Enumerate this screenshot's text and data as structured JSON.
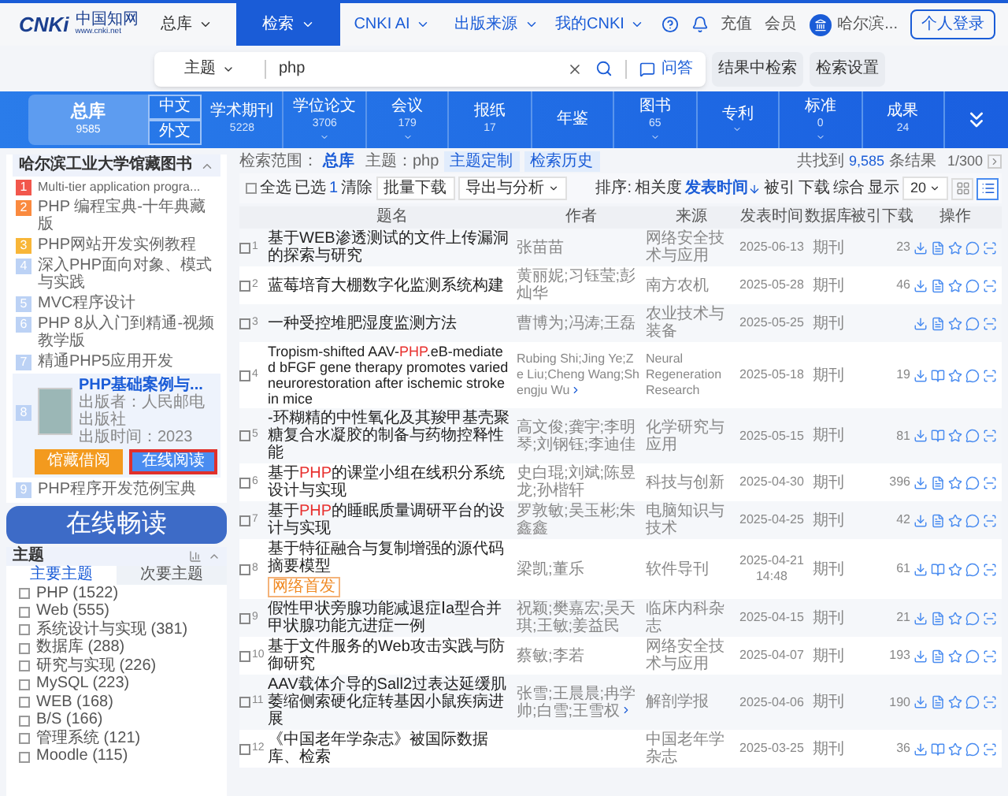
{
  "header": {
    "logo": {
      "mark": "CNKi",
      "name": "中国知网",
      "url": "www.cnki.net"
    },
    "library_menu": "总库",
    "nav": [
      {
        "label": "检索",
        "selected": true
      },
      {
        "label": "CNKI AI",
        "selected": false
      },
      {
        "label": "出版来源",
        "selected": false
      },
      {
        "label": "我的CNKI",
        "selected": false
      }
    ],
    "links": [
      "充值",
      "会员"
    ],
    "user": "哈尔滨...",
    "login": "个人登录"
  },
  "search": {
    "field": "主题",
    "value": "php",
    "qa": "问答",
    "buttons": [
      "结果中检索",
      "检索设置"
    ]
  },
  "db_band": {
    "total": {
      "label": "总库",
      "count": "9585",
      "selected": true
    },
    "langs": [
      {
        "label": "中文",
        "selected": false
      },
      {
        "label": "外文",
        "selected": false
      }
    ],
    "categories": [
      {
        "label": "学术期刊",
        "count": "5228",
        "has_menu": false
      },
      {
        "label": "学位论文",
        "count": "3706",
        "has_menu": true
      },
      {
        "label": "会议",
        "count": "179",
        "has_menu": true
      },
      {
        "label": "报纸",
        "count": "17",
        "has_menu": false
      },
      {
        "label": "年鉴",
        "has_menu": false
      },
      {
        "label": "图书",
        "count": "65",
        "has_menu": true
      },
      {
        "label": "专利",
        "has_menu": true
      },
      {
        "label": "标准",
        "count": "0",
        "has_menu": true
      },
      {
        "label": "成果",
        "count": "24",
        "has_menu": false
      }
    ]
  },
  "library": {
    "title": "哈尔滨工业大学馆藏图书",
    "expanded": true,
    "items": [
      {
        "kind": "line",
        "rank": "1",
        "color": "#f2574c",
        "title": "Multi-tier application progra..."
      },
      {
        "kind": "line",
        "rank": "2",
        "color": "#fa8a3f",
        "title": "PHP 编程宝典-十年典藏版"
      },
      {
        "kind": "line",
        "rank": "3",
        "color": "#f8b638",
        "title": "PHP网站开发实例教程"
      },
      {
        "kind": "line",
        "rank": "4",
        "color": "#bcd2f5",
        "title": "深入PHP面向对象、模式与实践"
      },
      {
        "kind": "line",
        "rank": "5",
        "color": "#bcd2f5",
        "title": "MVC程序设计"
      },
      {
        "kind": "line",
        "rank": "6",
        "color": "#bcd2f5",
        "title": "PHP 8从入门到精通-视频教学版"
      },
      {
        "kind": "line",
        "rank": "7",
        "color": "#bcd2f5",
        "title": "精通PHP5应用开发"
      },
      {
        "kind": "card",
        "rank": "8",
        "color": "#bcd2f5",
        "title": "PHP基础案例与...",
        "publisher": "出版者：人民邮电出版社",
        "year": "出版时间：2023",
        "buttons": [
          {
            "label": "馆藏借阅",
            "highlighted": false
          },
          {
            "label": "在线阅读",
            "highlighted": true
          }
        ]
      },
      {
        "kind": "line",
        "rank": "9",
        "color": "#bcd2f5",
        "title": "PHP程序开发范例宝典"
      }
    ]
  },
  "overlay_caption": "在线畅读",
  "subjects": {
    "title": "主题",
    "expanded": true,
    "tabs": [
      {
        "label": "主要主题",
        "selected": true
      },
      {
        "label": "次要主题",
        "selected": false
      }
    ],
    "items": [
      {
        "label": "PHP (1522)",
        "checked": false
      },
      {
        "label": "Web (555)",
        "checked": false
      },
      {
        "label": "系统设计与实现 (381)",
        "checked": false
      },
      {
        "label": "数据库 (288)",
        "checked": false
      },
      {
        "label": "研究与实现 (226)",
        "checked": false
      },
      {
        "label": "MySQL (223)",
        "checked": false
      },
      {
        "label": "WEB (168)",
        "checked": false
      },
      {
        "label": "B/S (166)",
        "checked": false
      },
      {
        "label": "管理系统 (121)",
        "checked": false
      },
      {
        "label": "Moodle (115)",
        "checked": false
      }
    ]
  },
  "results": {
    "scope_label": "检索范围：",
    "scope": "总库",
    "query": "主题：php",
    "tags": [
      "主题定制",
      "检索历史"
    ],
    "found_prefix": "共找到",
    "found": "9,585",
    "found_suffix": "条结果",
    "page": "1/300",
    "toolbar": {
      "select_all": {
        "label": "全选",
        "checked": false
      },
      "selected_label": "已选",
      "selected_count": "1",
      "clear": "清除",
      "buttons": [
        {
          "label": "批量下载",
          "has_menu": false
        },
        {
          "label": "导出与分析",
          "has_menu": true
        }
      ],
      "sort_label": "排序:",
      "sorts": [
        {
          "label": "相关度",
          "selected": false
        },
        {
          "label": "发表时间",
          "selected": true
        },
        {
          "label": "被引",
          "selected": false
        },
        {
          "label": "下载",
          "selected": false
        },
        {
          "label": "综合",
          "selected": false
        }
      ],
      "page_size_label": "显示",
      "page_size": "20",
      "views": [
        {
          "kind": "grid",
          "selected": false
        },
        {
          "kind": "list",
          "selected": true
        }
      ]
    },
    "columns": [
      "题名",
      "作者",
      "来源",
      "发表时间",
      "数据库",
      "被引",
      "下载",
      "操作"
    ],
    "rows": [
      {
        "no": "1",
        "checked": false,
        "title": [
          {
            "text": "基于WEB渗透测试的文件上传漏洞的探索与研究",
            "hit": false
          }
        ],
        "authors": "张苗苗",
        "source": "网络安全技术与应用",
        "date": "2025-06-13",
        "db": "期刊",
        "downloads": "23",
        "kind": "document"
      },
      {
        "no": "2",
        "checked": false,
        "title": [
          {
            "text": "蓝莓培育大棚数字化监测系统构建",
            "hit": false
          }
        ],
        "authors": "黄丽妮;习钰莹;彭灿华",
        "source": "南方农机",
        "date": "2025-05-28",
        "db": "期刊",
        "downloads": "46",
        "kind": "document"
      },
      {
        "no": "3",
        "checked": false,
        "title": [
          {
            "text": "一种受控堆肥湿度监测方法",
            "hit": false
          }
        ],
        "authors": "曹博为;冯涛;王磊",
        "source": "农业技术与装备",
        "date": "2025-05-25",
        "db": "期刊",
        "kind": "document"
      },
      {
        "no": "4",
        "checked": false,
        "title": [
          {
            "text": "Tropism-shifted AAV-",
            "hit": false
          },
          {
            "text": "PHP",
            "hit": true
          },
          {
            "text": ".eB-mediated bFGF gene therapy promotes varied neurorestoration after ischemic stroke in mice",
            "hit": false
          }
        ],
        "authors": "Rubing Shi;Jing Ye;Ze Liu;Cheng Wang;Shengju Wu",
        "more_authors": true,
        "source": "Neural Regeneration Research",
        "date": "2025-05-18",
        "db": "期刊",
        "downloads": "19",
        "kind": "book"
      },
      {
        "no": "5",
        "checked": false,
        "title": [
          {
            "text": "-环糊精的中性氧化及其羧甲基壳聚糖复合水凝胶的制备与药物控释性能",
            "hit": false
          }
        ],
        "authors": "高文俊;龚宇;李明琴;刘钢钰;李迪佳",
        "more_authors": false,
        "source": "化学研究与应用",
        "date": "2025-05-15",
        "db": "期刊",
        "downloads": "81",
        "kind": "book"
      },
      {
        "no": "6",
        "checked": false,
        "title": [
          {
            "text": "基于",
            "hit": false
          },
          {
            "text": "PHP",
            "hit": true
          },
          {
            "text": "的课堂小组在线积分系统设计与实现",
            "hit": false
          }
        ],
        "authors": "史白琨;刘斌;陈昱龙;孙楷轩",
        "source": "科技与创新",
        "date": "2025-04-30",
        "db": "期刊",
        "downloads": "396",
        "kind": "document"
      },
      {
        "no": "7",
        "checked": false,
        "title": [
          {
            "text": "基于",
            "hit": false
          },
          {
            "text": "PHP",
            "hit": true
          },
          {
            "text": "的睡眠质量调研平台的设计与实现",
            "hit": false
          }
        ],
        "authors": "罗敦敏;吴玉彬;朱鑫鑫",
        "source": "电脑知识与技术",
        "date": "2025-04-25",
        "db": "期刊",
        "downloads": "42",
        "kind": "document"
      },
      {
        "no": "8",
        "checked": false,
        "title": [
          {
            "text": "基于特征融合与复制增强的源代码摘要模型",
            "hit": false
          }
        ],
        "badge": "网络首发",
        "authors": "梁凯;董乐",
        "source": "软件导刊",
        "date": "2025-04-21 14:48",
        "db": "期刊",
        "downloads": "61",
        "kind": "book"
      },
      {
        "no": "9",
        "checked": false,
        "title": [
          {
            "text": "假性甲状旁腺功能减退症Ⅰa型合并甲状腺功能亢进症一例",
            "hit": false
          }
        ],
        "authors": "祝颖;樊嘉宏;吴天琪;王敏;姜益民",
        "source": "临床内科杂志",
        "date": "2025-04-15",
        "db": "期刊",
        "downloads": "21",
        "kind": "document"
      },
      {
        "no": "10",
        "checked": false,
        "title": [
          {
            "text": "基于文件服务的Web攻击实践与防御研究",
            "hit": false
          }
        ],
        "authors": "蔡敏;李若",
        "source": "网络安全技术与应用",
        "date": "2025-04-07",
        "db": "期刊",
        "downloads": "193",
        "kind": "document"
      },
      {
        "no": "11",
        "checked": false,
        "title": [
          {
            "text": "AAV载体介导的Sall2过表达延缓肌萎缩侧索硬化症转基因小鼠疾病进展",
            "hit": false
          }
        ],
        "authors": "张雪;王晨晨;冉学帅;白雪;王雪权",
        "more_authors": true,
        "source": "解剖学报",
        "date": "2025-04-06",
        "db": "期刊",
        "downloads": "190",
        "kind": "document"
      },
      {
        "no": "12",
        "checked": false,
        "title": [
          {
            "text": "《中国老年学杂志》被国际数据库、检索",
            "hit": false
          }
        ],
        "source": "中国老年学杂志",
        "date": "2025-03-25",
        "db": "期刊",
        "downloads": "36",
        "kind": "book"
      }
    ]
  }
}
